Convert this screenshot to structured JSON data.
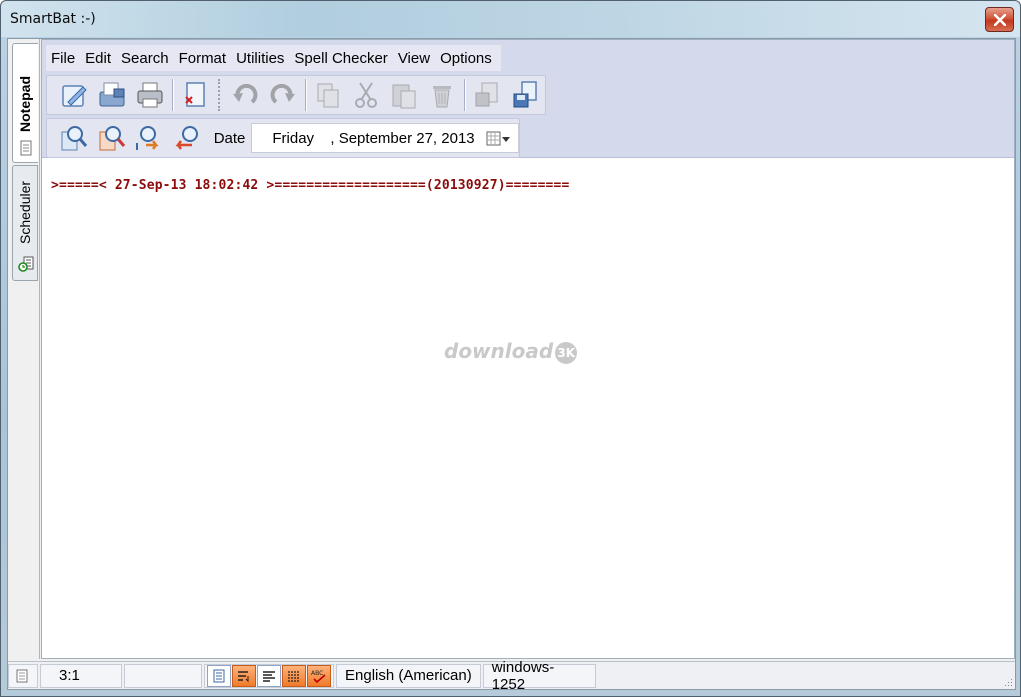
{
  "window": {
    "title": "SmartBat :-)"
  },
  "sidetabs": [
    {
      "label": "Notepad",
      "icon": "notepad-page-icon",
      "active": true
    },
    {
      "label": "Scheduler",
      "icon": "scheduler-clock-icon",
      "active": false
    }
  ],
  "menu": {
    "items": [
      "File",
      "Edit",
      "Search",
      "Format",
      "Utilities",
      "Spell Checker",
      "View",
      "Options"
    ]
  },
  "toolbar1": {
    "buttons": [
      "edit-pen-icon",
      "open-folder-icon",
      "print-icon",
      "close-doc-icon",
      "undo-icon",
      "redo-icon",
      "copy-icon",
      "cut-icon",
      "paste-icon",
      "delete-icon",
      "save-icon",
      "save-as-icon"
    ]
  },
  "toolbar2": {
    "buttons": [
      "find-icon",
      "find-next-icon",
      "replace-icon",
      "goto-icon"
    ],
    "date_label": "Date",
    "date_day": "Friday",
    "date_rest": ", September 27, 2013"
  },
  "editor": {
    "line1": ">=====< 27-Sep-13 18:02:42 >===================(20130927)========",
    "watermark": "download",
    "watermark_badge": "3K"
  },
  "statusbar": {
    "position": "3:1",
    "language": "English (American)",
    "encoding": "windows-1252"
  },
  "colors": {
    "text_red": "#8b0a0a",
    "toolbar_bg": "#d5d9ec",
    "status_orange": "#f07a2a"
  }
}
